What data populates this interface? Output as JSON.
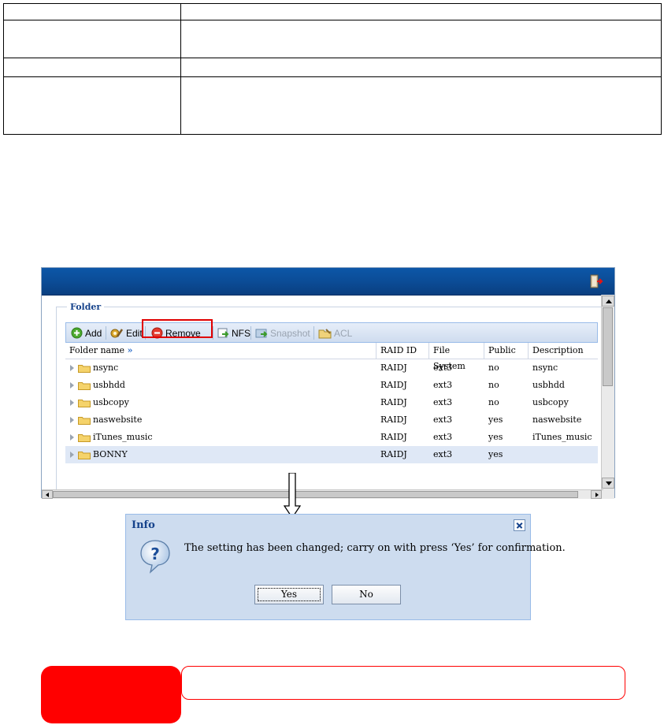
{
  "folder_panel": {
    "legend": "Folder",
    "toolbar": {
      "add": "Add",
      "edit": "Edit",
      "remove": "Remove",
      "nfs": "NFS",
      "snapshot": "Snapshot",
      "acl": "ACL"
    },
    "columns": [
      "Folder name",
      "RAID ID",
      "File System",
      "Public",
      "Description"
    ],
    "column_sort_glyph": "»",
    "rows": [
      {
        "name": "nsync",
        "raid": "RAIDJ",
        "fs": "ext3",
        "public": "no",
        "desc": "nsync"
      },
      {
        "name": "usbhdd",
        "raid": "RAIDJ",
        "fs": "ext3",
        "public": "no",
        "desc": "usbhdd"
      },
      {
        "name": "usbcopy",
        "raid": "RAIDJ",
        "fs": "ext3",
        "public": "no",
        "desc": "usbcopy"
      },
      {
        "name": "naswebsite",
        "raid": "RAIDJ",
        "fs": "ext3",
        "public": "yes",
        "desc": "naswebsite"
      },
      {
        "name": "iTunes_music",
        "raid": "RAIDJ",
        "fs": "ext3",
        "public": "yes",
        "desc": "iTunes_music"
      },
      {
        "name": "BONNY",
        "raid": "RAIDJ",
        "fs": "ext3",
        "public": "yes",
        "desc": ""
      }
    ],
    "selected_row_index": 5
  },
  "dialog": {
    "title": "Info",
    "message": "The setting has been changed; carry on with press ‘Yes’ for confirmation.",
    "yes_label": "Yes",
    "no_label": "No"
  },
  "colors": {
    "title_bar": "#0b4c97",
    "highlight": "#e00000",
    "note_red": "#ff0000",
    "selected_row": "#dfe8f6"
  },
  "icons": [
    "add-icon",
    "edit-icon",
    "remove-icon",
    "nfs-icon",
    "snapshot-icon",
    "acl-icon",
    "folder-icon",
    "exit-icon",
    "question-icon",
    "close-icon"
  ]
}
